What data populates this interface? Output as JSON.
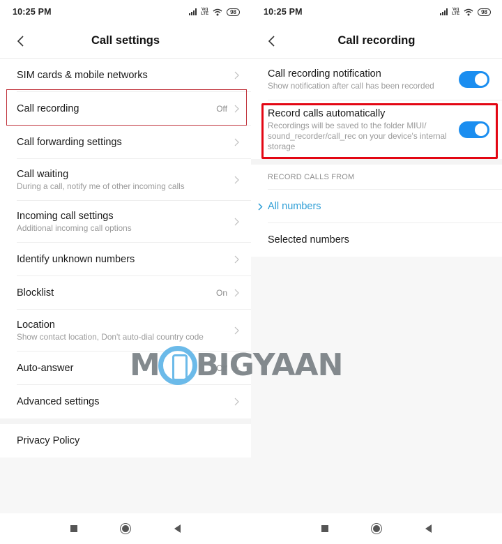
{
  "status_bar": {
    "time": "10:25 PM",
    "volte_top": "Vo)",
    "volte_bottom": "LTE",
    "battery": "98"
  },
  "left": {
    "title": "Call settings",
    "items": [
      {
        "label": "SIM cards & mobile networks",
        "sub": "",
        "value": ""
      },
      {
        "label": "Call recording",
        "sub": "",
        "value": "Off"
      },
      {
        "label": "Call forwarding settings",
        "sub": "",
        "value": ""
      },
      {
        "label": "Call waiting",
        "sub": "During a call, notify me of other incoming calls",
        "value": ""
      },
      {
        "label": "Incoming call settings",
        "sub": "Additional incoming call options",
        "value": ""
      },
      {
        "label": "Identify unknown numbers",
        "sub": "",
        "value": ""
      },
      {
        "label": "Blocklist",
        "sub": "",
        "value": "On"
      },
      {
        "label": "Location",
        "sub": "Show contact location, Don't auto-dial country code",
        "value": ""
      },
      {
        "label": "Auto-answer",
        "sub": "",
        "value": "Off"
      },
      {
        "label": "Advanced settings",
        "sub": "",
        "value": ""
      }
    ],
    "privacy": "Privacy Policy"
  },
  "right": {
    "title": "Call recording",
    "toggles": [
      {
        "label": "Call recording notification",
        "sub": "Show notification after call has been recorded",
        "on": true
      },
      {
        "label": "Record calls automatically",
        "sub": "Recordings will be saved to the folder MIUI/ sound_recorder/call_rec on your device's internal storage",
        "on": true
      }
    ],
    "section_header": "RECORD CALLS FROM",
    "options": [
      {
        "label": "All numbers",
        "selected": true
      },
      {
        "label": "Selected numbers",
        "selected": false
      }
    ]
  },
  "watermark": {
    "left": "M",
    "right": "BIGYAAN"
  },
  "colors": {
    "accent": "#1b8ef0",
    "selected_text": "#2e9ed6",
    "highlight_red": "#e30613"
  }
}
